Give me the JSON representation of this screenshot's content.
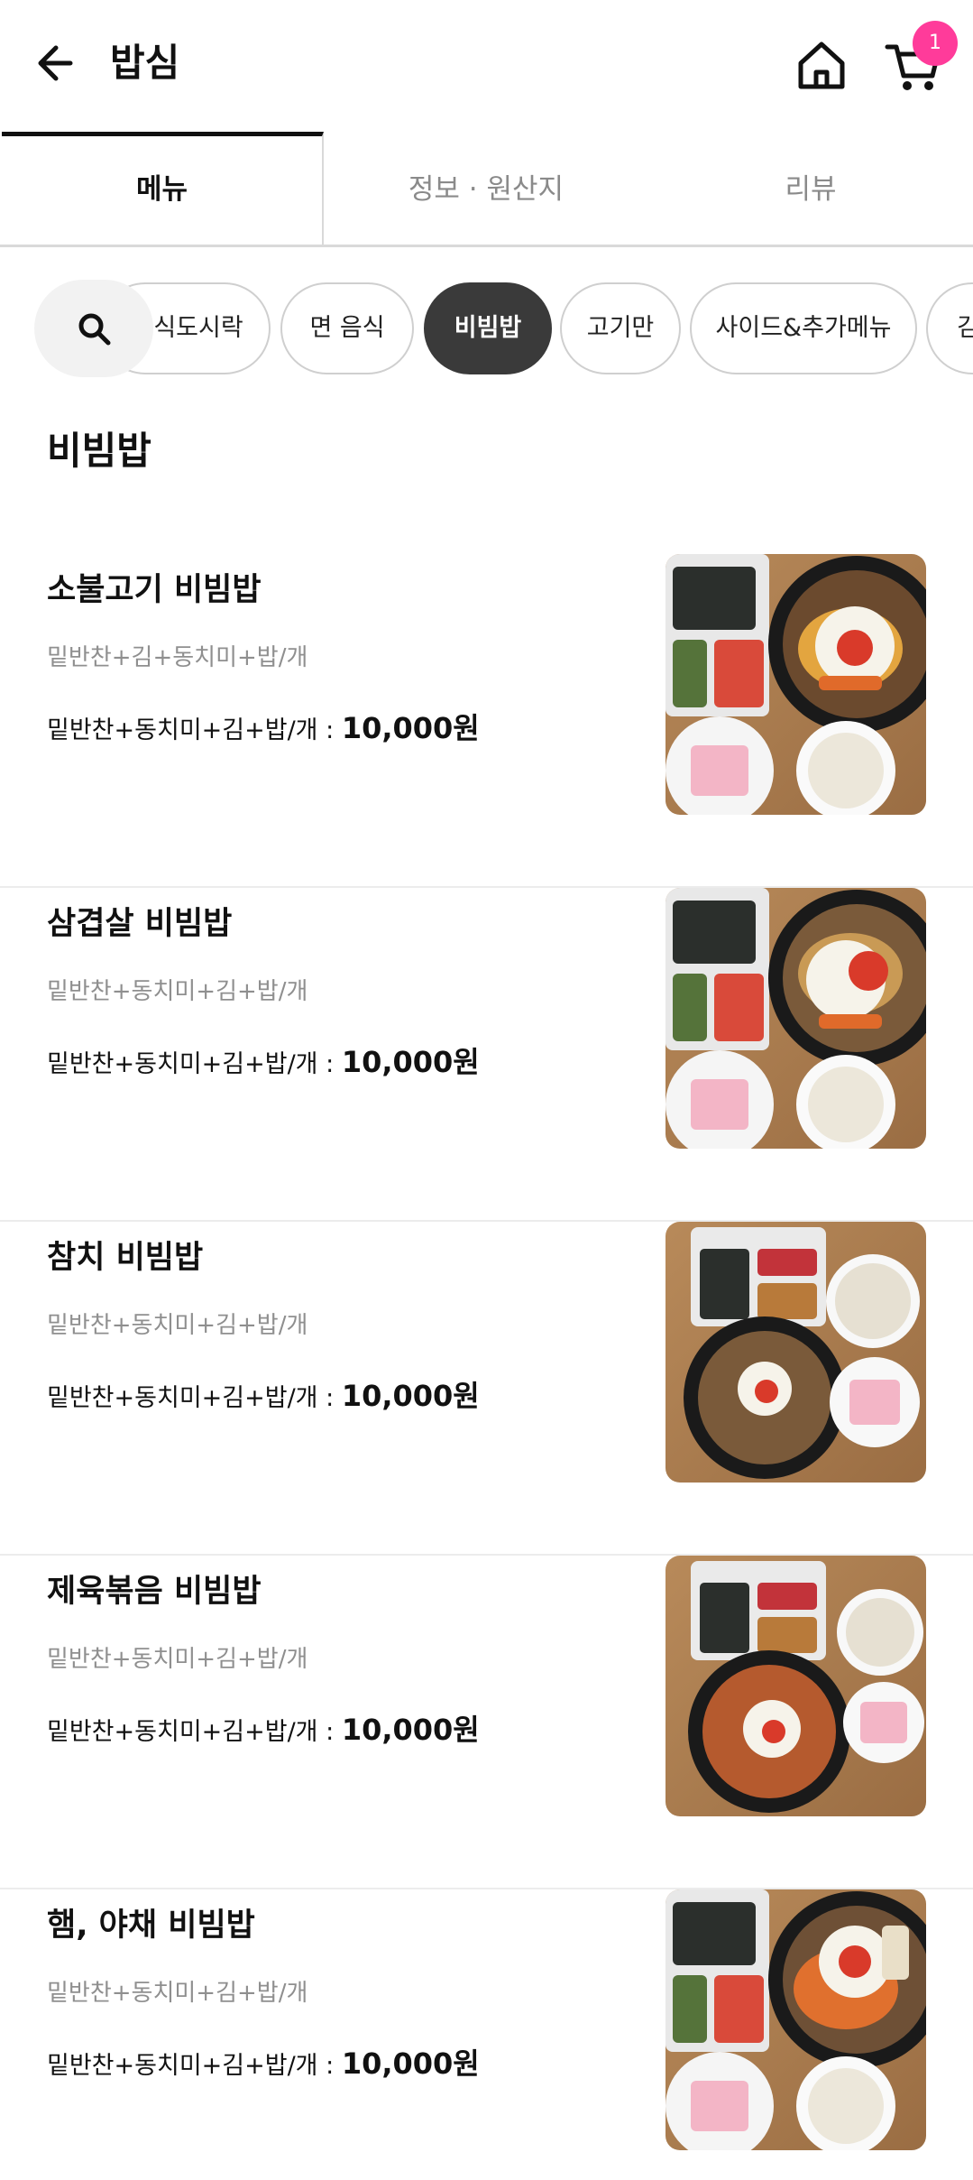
{
  "header": {
    "title": "밥심",
    "cart_badge": "1"
  },
  "tabs": [
    {
      "label": "메뉴",
      "active": true
    },
    {
      "label": "정보 · 원산지",
      "active": false
    },
    {
      "label": "리뷰",
      "active": false
    }
  ],
  "categories": [
    {
      "label": "식도시락",
      "active": false
    },
    {
      "label": "면 음식",
      "active": false
    },
    {
      "label": "비빔밥",
      "active": true
    },
    {
      "label": "고기만",
      "active": false
    },
    {
      "label": "사이드&추가메뉴",
      "active": false
    },
    {
      "label": "김",
      "active": false
    }
  ],
  "section": {
    "title": "비빔밥"
  },
  "items": [
    {
      "name": "소불고기 비빔밥",
      "desc": "밑반찬+김+동치미+밥/개",
      "option": "밑반찬+동치미+김+밥/개 :",
      "price": "10,000원",
      "image": "bibimbap-photo-a"
    },
    {
      "name": "삼겹살 비빔밥",
      "desc": "밑반찬+동치미+김+밥/개",
      "option": "밑반찬+동치미+김+밥/개 :",
      "price": "10,000원",
      "image": "bibimbap-photo-a"
    },
    {
      "name": "참치 비빔밥",
      "desc": "밑반찬+동치미+김+밥/개",
      "option": "밑반찬+동치미+김+밥/개 :",
      "price": "10,000원",
      "image": "bibimbap-photo-b"
    },
    {
      "name": "제육볶음 비빔밥",
      "desc": "밑반찬+동치미+김+밥/개",
      "option": "밑반찬+동치미+김+밥/개 :",
      "price": "10,000원",
      "image": "bibimbap-photo-b"
    },
    {
      "name": "햄, 야채 비빔밥",
      "desc": "밑반찬+동치미+김+밥/개",
      "option": "밑반찬+동치미+김+밥/개 :",
      "price": "10,000원",
      "image": "bibimbap-photo-a"
    }
  ],
  "colors": {
    "badge": "#ff3b9a",
    "active_chip": "#3a3a3a",
    "muted_text": "#8f8f8f"
  }
}
